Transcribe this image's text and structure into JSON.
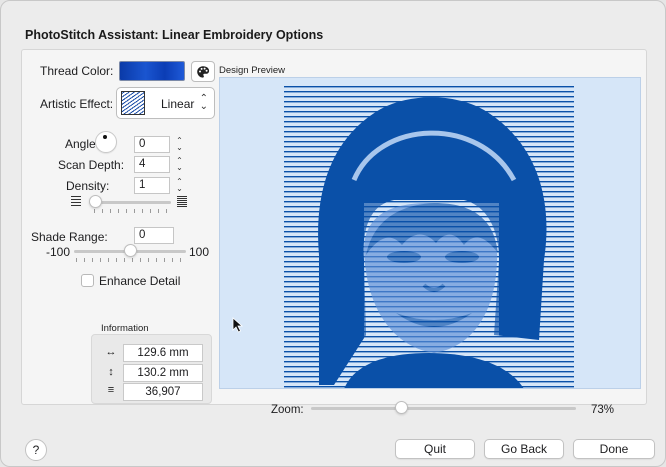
{
  "dialog": {
    "title": "PhotoStitch Assistant: Linear Embroidery Options"
  },
  "thread": {
    "label": "Thread Color:",
    "color": "#1447c0",
    "palette_icon": "palette-icon"
  },
  "effect": {
    "label": "Artistic Effect:",
    "value": "Linear"
  },
  "preview": {
    "label": "Design Preview"
  },
  "angle": {
    "label": "Angle:",
    "value": "0"
  },
  "scan_depth": {
    "label": "Scan Depth:",
    "value": "4"
  },
  "density": {
    "label": "Density:",
    "value": "1",
    "slider_fraction": 0.06
  },
  "shade_range": {
    "label": "Shade Range:",
    "value": "0",
    "min": "-100",
    "max": "100",
    "slider_fraction": 0.5
  },
  "enhance_detail": {
    "label": "Enhance Detail",
    "checked": false
  },
  "information": {
    "title": "Information",
    "width": "129.6 mm",
    "height": "130.2 mm",
    "stitches": "36,907"
  },
  "zoom": {
    "label": "Zoom:",
    "value": "73%",
    "slider_fraction": 0.34
  },
  "buttons": {
    "help": "?",
    "quit": "Quit",
    "back": "Go Back",
    "done": "Done"
  },
  "colors": {
    "accent_blue": "#0a50a8",
    "preview_bg": "#d6e6f8"
  }
}
